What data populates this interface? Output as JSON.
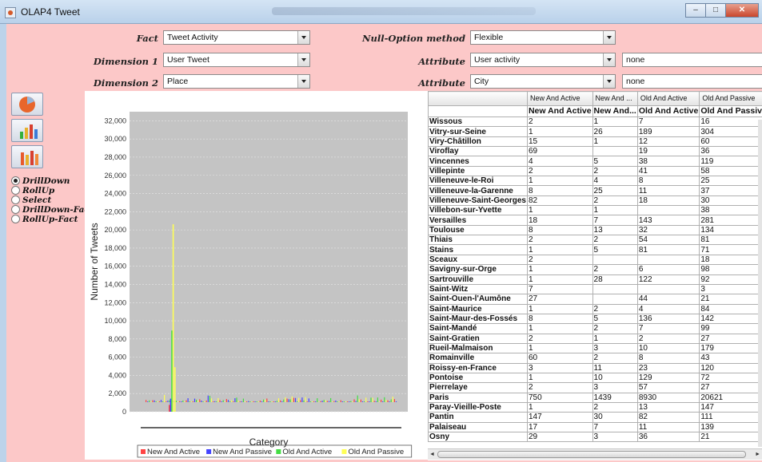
{
  "window": {
    "title": "OLAP4 Tweet"
  },
  "controls": {
    "fact": {
      "label": "Fact",
      "value": "Tweet Activity"
    },
    "null_option": {
      "label": "Null-Option method",
      "value": "Flexible"
    },
    "dimension1": {
      "label": "Dimension 1",
      "value": "User Tweet"
    },
    "attribute1": {
      "label": "Attribute",
      "value": "User activity",
      "value2": "none"
    },
    "dimension2": {
      "label": "Dimension 2",
      "value": "Place"
    },
    "attribute2": {
      "label": "Attribute",
      "value": "City",
      "value2": "none"
    }
  },
  "operations": [
    {
      "label": "DrillDown",
      "selected": true
    },
    {
      "label": "RollUp",
      "selected": false
    },
    {
      "label": "Select",
      "selected": false
    },
    {
      "label": "DrillDown-Fact",
      "selected": false
    },
    {
      "label": "RollUp-Fact",
      "selected": false
    }
  ],
  "chart_data": {
    "type": "bar",
    "xlabel": "Category",
    "ylabel": "Number of Tweets",
    "ylim": [
      0,
      33000
    ],
    "yticks": [
      0,
      2000,
      4000,
      6000,
      8000,
      10000,
      12000,
      14000,
      16000,
      18000,
      20000,
      22000,
      24000,
      26000,
      28000,
      30000,
      32000
    ],
    "series": [
      {
        "name": "New And Active",
        "color": "#ff4444"
      },
      {
        "name": "New And Passive",
        "color": "#4444ff"
      },
      {
        "name": "Old And Active",
        "color": "#44dd44"
      },
      {
        "name": "Old And Passive",
        "color": "#ffff55"
      }
    ],
    "highlight": {
      "values": [
        750,
        1439,
        8930,
        20621
      ]
    },
    "extra_spikes": [
      {
        "value": 4900
      }
    ]
  },
  "table": {
    "col_headers": [
      "",
      "New And Active",
      "New And ...",
      "Old And Active",
      "Old And Passive"
    ],
    "sub_headers": [
      "",
      "New And Active",
      "New And...",
      "Old And Active",
      "Old And Passive"
    ],
    "rows": [
      [
        "Wissous",
        "2",
        "1",
        "7",
        "16"
      ],
      [
        "Vitry-sur-Seine",
        "1",
        "26",
        "189",
        "304"
      ],
      [
        "Viry-Châtillon",
        "15",
        "1",
        "12",
        "60"
      ],
      [
        "Viroflay",
        "69",
        "",
        "19",
        "36"
      ],
      [
        "Vincennes",
        "4",
        "5",
        "38",
        "119"
      ],
      [
        "Villepinte",
        "2",
        "2",
        "41",
        "58"
      ],
      [
        "Villeneuve-le-Roi",
        "1",
        "4",
        "8",
        "25"
      ],
      [
        "Villeneuve-la-Garenne",
        "8",
        "25",
        "11",
        "37"
      ],
      [
        "Villeneuve-Saint-Georges",
        "82",
        "2",
        "18",
        "30"
      ],
      [
        "Villebon-sur-Yvette",
        "1",
        "1",
        "",
        "38"
      ],
      [
        "Versailles",
        "18",
        "7",
        "143",
        "281"
      ],
      [
        "Toulouse",
        "8",
        "13",
        "32",
        "134"
      ],
      [
        "Thiais",
        "2",
        "2",
        "54",
        "81"
      ],
      [
        "Stains",
        "1",
        "5",
        "81",
        "71"
      ],
      [
        "Sceaux",
        "2",
        "",
        "",
        "18"
      ],
      [
        "Savigny-sur-Orge",
        "1",
        "2",
        "6",
        "98"
      ],
      [
        "Sartrouville",
        "1",
        "28",
        "122",
        "92"
      ],
      [
        "Saint-Witz",
        "7",
        "",
        "",
        "3"
      ],
      [
        "Saint-Ouen-l'Aumône",
        "27",
        "",
        "44",
        "21"
      ],
      [
        "Saint-Maurice",
        "1",
        "2",
        "4",
        "84"
      ],
      [
        "Saint-Maur-des-Fossés",
        "8",
        "5",
        "136",
        "142"
      ],
      [
        "Saint-Mandé",
        "1",
        "2",
        "7",
        "99"
      ],
      [
        "Saint-Gratien",
        "2",
        "1",
        "2",
        "27"
      ],
      [
        "Rueil-Malmaison",
        "1",
        "3",
        "10",
        "179"
      ],
      [
        "Romainville",
        "60",
        "2",
        "8",
        "43"
      ],
      [
        "Roissy-en-France",
        "3",
        "11",
        "23",
        "120"
      ],
      [
        "Pontoise",
        "1",
        "10",
        "129",
        "72"
      ],
      [
        "Pierrelaye",
        "2",
        "3",
        "57",
        "27"
      ],
      [
        "Paris",
        "750",
        "1439",
        "8930",
        "20621"
      ],
      [
        "Paray-Vieille-Poste",
        "1",
        "2",
        "13",
        "147"
      ],
      [
        "Pantin",
        "147",
        "30",
        "82",
        "111"
      ],
      [
        "Palaiseau",
        "17",
        "7",
        "11",
        "139"
      ],
      [
        "Osny",
        "29",
        "3",
        "36",
        "21"
      ]
    ]
  }
}
